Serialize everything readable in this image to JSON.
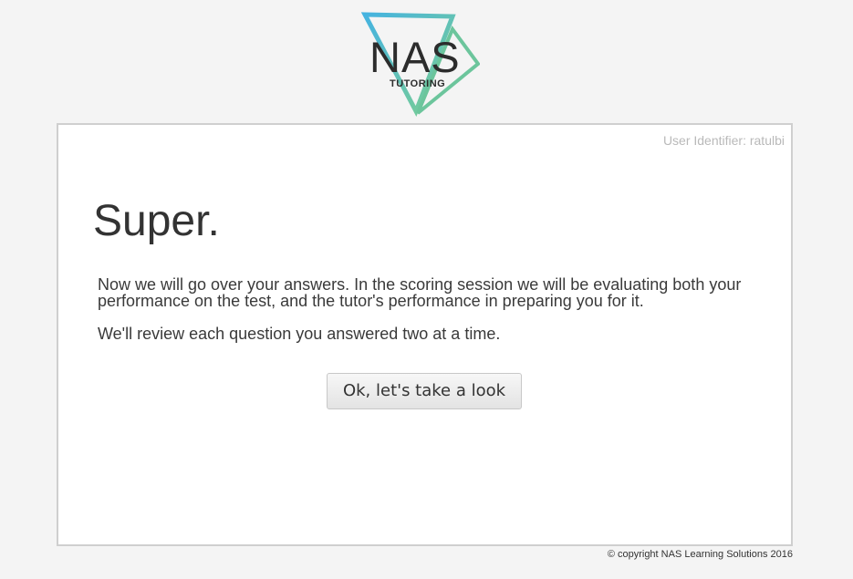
{
  "logo": {
    "main_text": "NAS",
    "sub_text": "TUTORING"
  },
  "panel": {
    "user_identifier": "User Identifier: ratulbi",
    "heading": "Super.",
    "paragraphs": [
      "Now we will go over your answers. In the scoring session we will be evaluating both your performance on the test, and the tutor's performance in preparing you for it.",
      "We'll review each question you answered two at a time."
    ],
    "button_label": "Ok, let's take a look"
  },
  "footer": {
    "copyright": "© copyright NAS Learning Solutions 2016"
  },
  "colors": {
    "logo_blue": "#4fb8dd",
    "logo_green": "#6cc59c",
    "panel_border": "#cfcfcf",
    "background": "#f4f4f4"
  }
}
